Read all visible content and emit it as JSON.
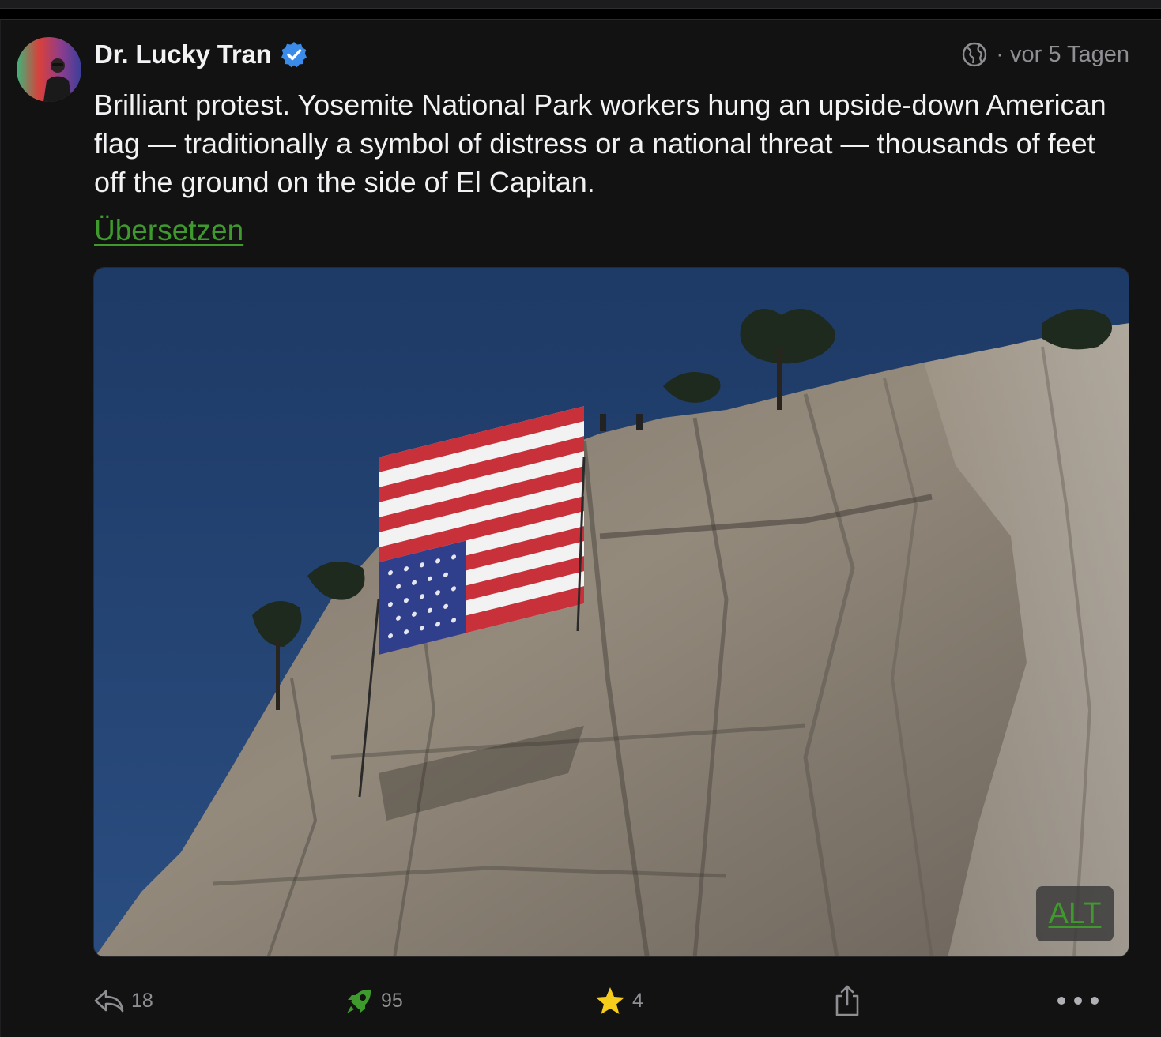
{
  "post": {
    "author": {
      "display_name": "Dr. Lucky Tran",
      "verified": true,
      "avatar_icon": "avatar-photo"
    },
    "meta": {
      "visibility_icon": "globe-icon",
      "timestamp": "· vor 5 Tagen"
    },
    "text": "Brilliant protest. Yosemite National Park workers hung an upside-down American flag — traditionally a symbol of distress or a national threat — thousands of feet off the ground on the side of El Capitan.",
    "translate_label": "Übersetzen",
    "media": {
      "alt_label": "ALT"
    },
    "actions": {
      "reply_count": "18",
      "boost_count": "95",
      "favorite_count": "4"
    }
  },
  "colors": {
    "accent_green": "#3f9a2d",
    "verified_blue": "#3b8bea",
    "star_yellow": "#f5cc1c",
    "background": "#121212",
    "muted_text": "#8e8e93"
  }
}
